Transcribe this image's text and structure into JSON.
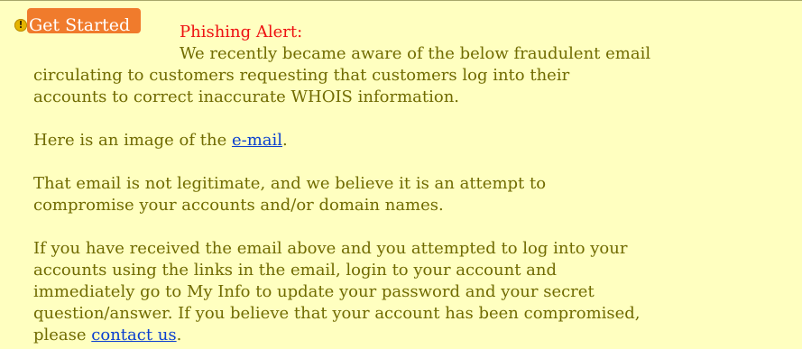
{
  "alert": {
    "button_label": "Get Started",
    "title": "Phishing Alert:",
    "intro_lines": [
      "We recently became aware of the below fraudulent email",
      "circulating to customers requesting that customers log into their",
      "accounts to correct inaccurate WHOIS information."
    ],
    "image_para": {
      "before": "Here is an image of the ",
      "link": "e-mail",
      "after": "."
    },
    "legit_lines": [
      "That email is not legitimate, and we believe it is an attempt to",
      "compromise your accounts and/or domain names."
    ],
    "action_lines": [
      "If you have received the email above and you attempted to log into your",
      "accounts using the links in the email, login to your account and",
      "immediately go to My Info to update your password and your secret",
      "question/answer. If you believe that your account has been compromised,"
    ],
    "contact_para": {
      "before": "please ",
      "link": "contact us",
      "after": "."
    }
  },
  "colors": {
    "background": "#ffffc0",
    "title": "#ee1111",
    "body_text": "#706b00",
    "link": "#0a3fd0",
    "button": "#f07b2c"
  },
  "icons": [
    "warning-icon"
  ]
}
